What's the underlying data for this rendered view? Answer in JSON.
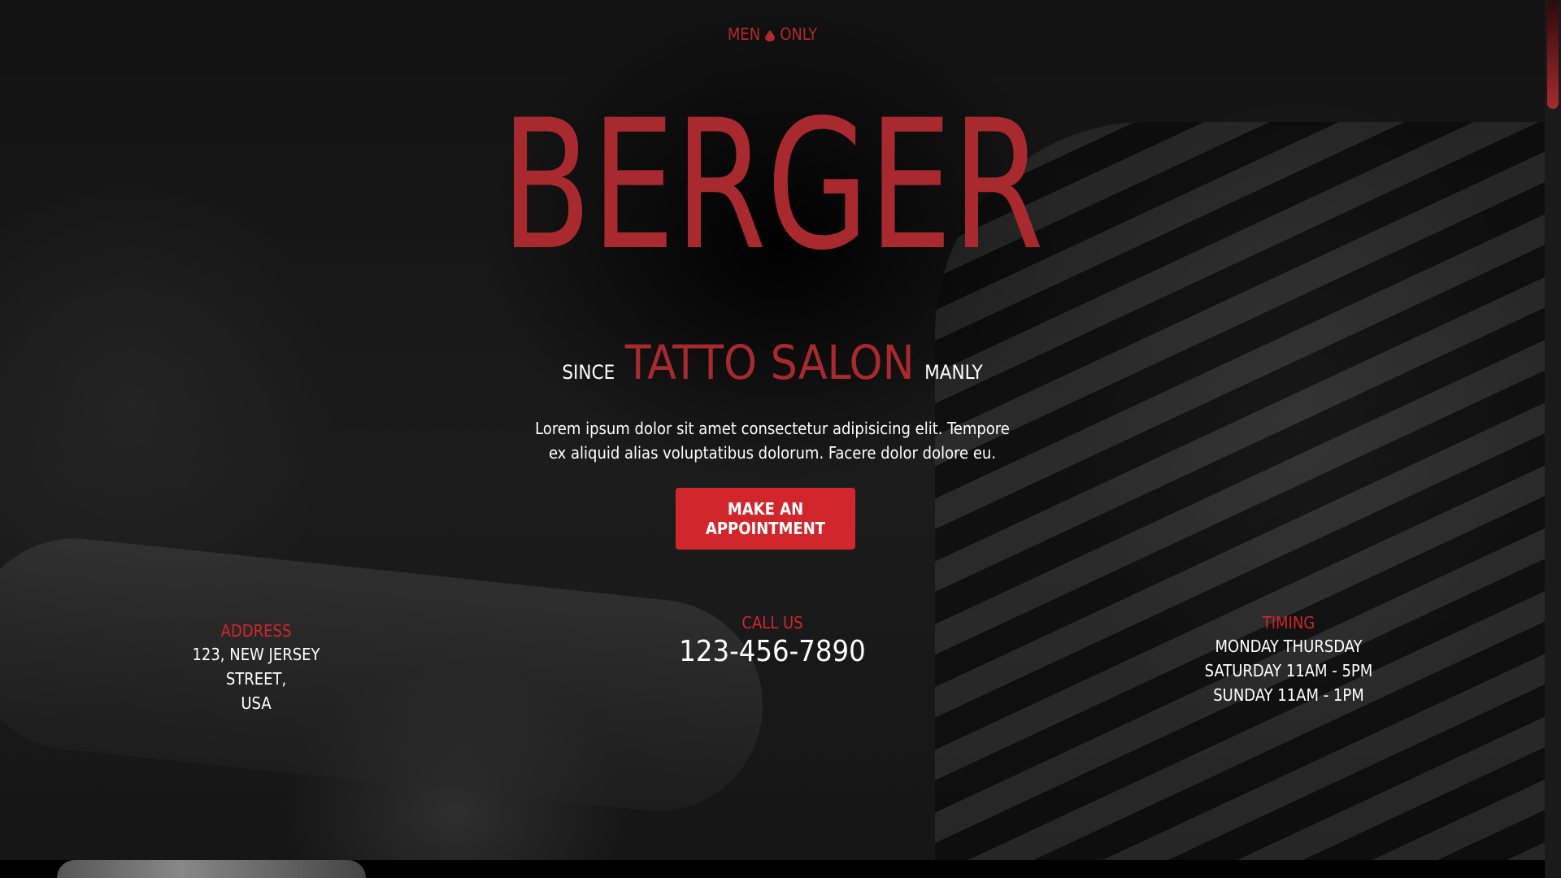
{
  "header": {
    "tag_left": "MEN",
    "tag_right": "ONLY",
    "drop_icon": "blood-drop-icon"
  },
  "hero": {
    "brand": "BERGER",
    "since_label": "SINCE",
    "salon_label": "TATTO SALON",
    "manly_label": "MANLY",
    "description": "Lorem ipsum dolor sit amet consectetur adipisicing elit. Tempore ex aliquid alias voluptatibus dolorum. Facere dolor dolore eu.",
    "cta_label": "MAKE AN APPOINTMENT"
  },
  "info": {
    "address": {
      "label": "ADDRESS",
      "line1": "123, NEW JERSEY STREET,",
      "line2": "USA"
    },
    "call": {
      "label": "CALL US",
      "phone": "123-456-7890"
    },
    "timing": {
      "label": "TIMING",
      "line1": "MONDAY THURSDAY",
      "line2": "SATURDAY 11AM - 5PM",
      "line3": "SUNDAY 11AM - 1PM"
    }
  },
  "colors": {
    "accent": "#d1262c",
    "brand_red": "#a82a2e",
    "text": "#ffffff",
    "background": "#000000"
  }
}
